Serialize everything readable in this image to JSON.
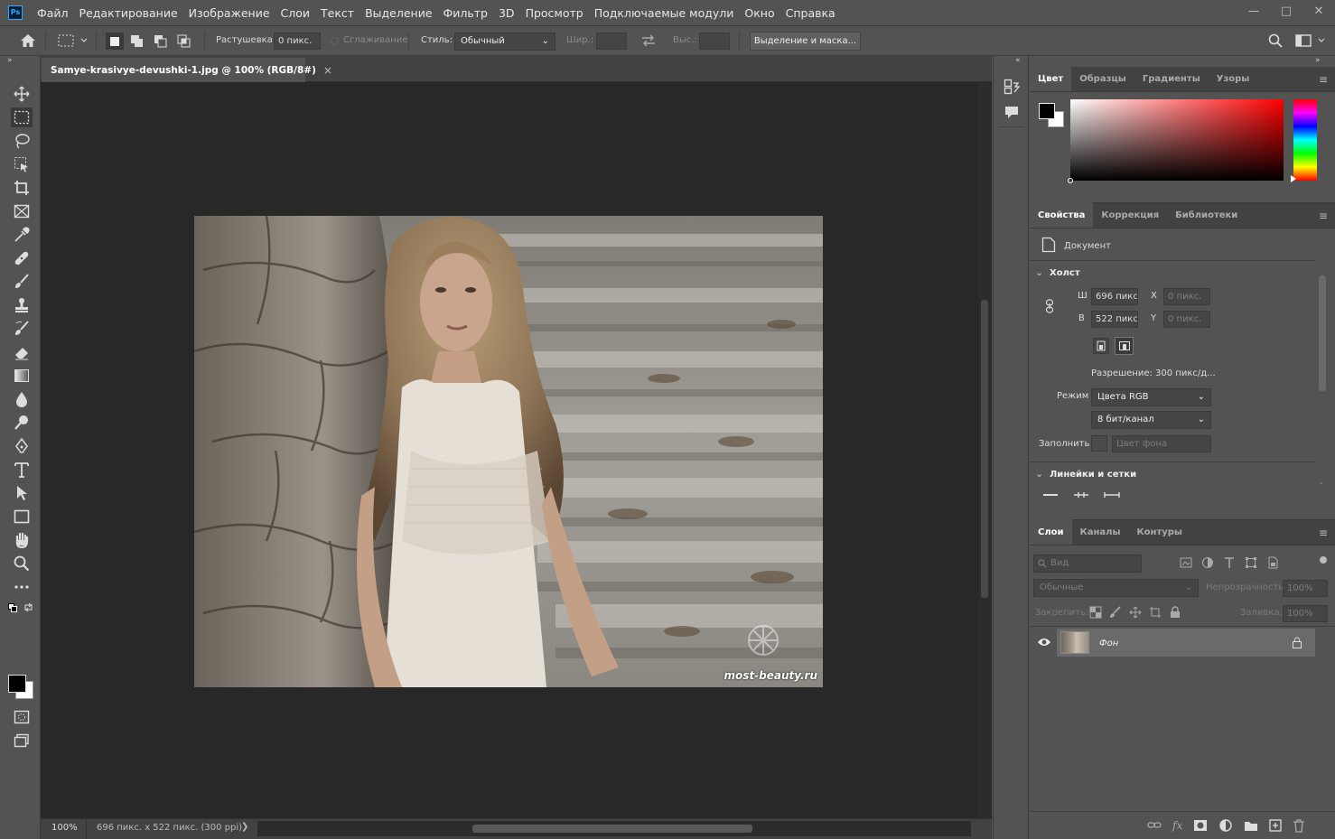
{
  "app": {
    "logo": "Ps"
  },
  "menu": [
    "Файл",
    "Редактирование",
    "Изображение",
    "Слои",
    "Текст",
    "Выделение",
    "Фильтр",
    "3D",
    "Просмотр",
    "Подключаемые модули",
    "Окно",
    "Справка"
  ],
  "window_controls": {
    "minimize": "—",
    "maximize": "□",
    "close": "✕"
  },
  "options": {
    "feather_label": "Растушевка:",
    "feather_value": "0 пикс.",
    "antialias_label": "Сглаживание",
    "style_label": "Стиль:",
    "style_value": "Обычный",
    "width_label": "Шир.:",
    "height_label": "Выс.:",
    "mask_button": "Выделение и маска..."
  },
  "document": {
    "tab_title": "Samye-krasivye-devushki-1.jpg @ 100% (RGB/8#)",
    "tab_close": "×",
    "watermark": "most-beauty.ru",
    "zoom": "100%",
    "info": "696 пикс. x 522 пикс. (300 ppi)",
    "status_arrow": "❯"
  },
  "panel_collapse": "«",
  "toolbar_collapse": "»",
  "color_panel": {
    "tabs": [
      "Цвет",
      "Образцы",
      "Градиенты",
      "Узоры"
    ],
    "active": 0,
    "foreground": "#000000",
    "background": "#ffffff",
    "hue_color": "#ff0000"
  },
  "properties_panel": {
    "tabs": [
      "Свойства",
      "Коррекция",
      "Библиотеки"
    ],
    "active": 0,
    "doc_label": "Документ",
    "canvas_header": "Холст",
    "w_label": "Ш",
    "w_value": "696 пикс.",
    "h_label": "В",
    "h_value": "522 пикс.",
    "x_label": "X",
    "x_value": "0 пикс.",
    "y_label": "Y",
    "y_value": "0 пикс.",
    "resolution": "Разрешение: 300 пикс/д...",
    "mode_label": "Режим",
    "mode_value": "Цвета RGB",
    "depth_value": "8 бит/канал",
    "fill_label": "Заполнить",
    "fill_value": "Цвет фона",
    "rulers_header": "Линейки и сетки"
  },
  "layers_panel": {
    "tabs": [
      "Слои",
      "Каналы",
      "Контуры"
    ],
    "active": 0,
    "filter_placeholder": "Вид",
    "blend_mode": "Обычные",
    "opacity_label": "Непрозрачность:",
    "opacity_value": "100%",
    "lock_label": "Закрепить:",
    "fill_label": "Заливка:",
    "fill_value": "100%",
    "layers": [
      {
        "name": "Фон",
        "visible": true,
        "locked": true
      }
    ],
    "footer_icons": [
      "link-icon",
      "fx-icon",
      "mask-icon",
      "adjustment-icon",
      "folder-icon",
      "new-layer-icon",
      "trash-icon"
    ]
  },
  "colors": {
    "accent": "#31a8ff",
    "panel": "#535353",
    "canvas": "#282828"
  }
}
